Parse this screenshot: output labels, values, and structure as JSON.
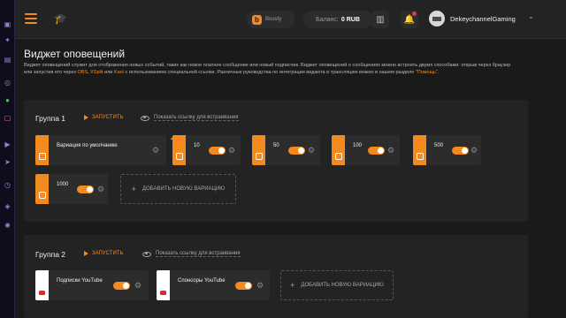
{
  "header": {
    "boosty_label": "Boosty",
    "balance_label": "Баланс:",
    "balance_value": "0 RUB",
    "username": "DekeychannelGaming",
    "avatar_text": "NIGHT"
  },
  "page": {
    "title": "Виджет оповещений",
    "desc_part1": "Виджет оповещений служит для отображения новых событий, таких как новое платное сообщение или новый подписчик. Виджет оповещений о сообщениях можно встроить двумя способами: открыв через браузер или запустив его через ",
    "desc_obs": "OBS",
    "desc_sep1": ", ",
    "desc_xsplit": "XSplit",
    "desc_sep2": " или ",
    "desc_kast": "Kast",
    "desc_part2": " с использованием специальной ссылки. Различные руководства по интеграции виджета в трансляцию можно в нашем разделе ",
    "desc_help": "\"Помощь\"",
    "desc_end": "."
  },
  "group1": {
    "title": "Группа 1",
    "run_label": "ЗАПУСТИТЬ",
    "show_link_label": "Показать ссылку для встраивания",
    "variations": [
      {
        "label": "Вариация по умолчанию",
        "enabled": false
      },
      {
        "label": "10",
        "enabled": true
      },
      {
        "label": "50",
        "enabled": true
      },
      {
        "label": "100",
        "enabled": true
      },
      {
        "label": "500",
        "enabled": true
      },
      {
        "label": "1000",
        "enabled": true
      }
    ],
    "add_label": "ДОБАВИТЬ НОВУЮ ВАРИАЦИЮ"
  },
  "group2": {
    "title": "Группа 2",
    "run_label": "ЗАПУСТИТЬ",
    "show_link_label": "Показать ссылку для встраивания",
    "variations": [
      {
        "label": "Подписки YouTube",
        "enabled": true
      },
      {
        "label": "Спонсоры YouTube",
        "enabled": true
      }
    ],
    "add_label": "ДОБАВИТЬ НОВУЮ ВАРИАЦИЮ"
  },
  "colors": {
    "accent": "#f28a1f",
    "background": "#1a1a1a",
    "panel": "#232323",
    "card": "#2c2c2c"
  }
}
